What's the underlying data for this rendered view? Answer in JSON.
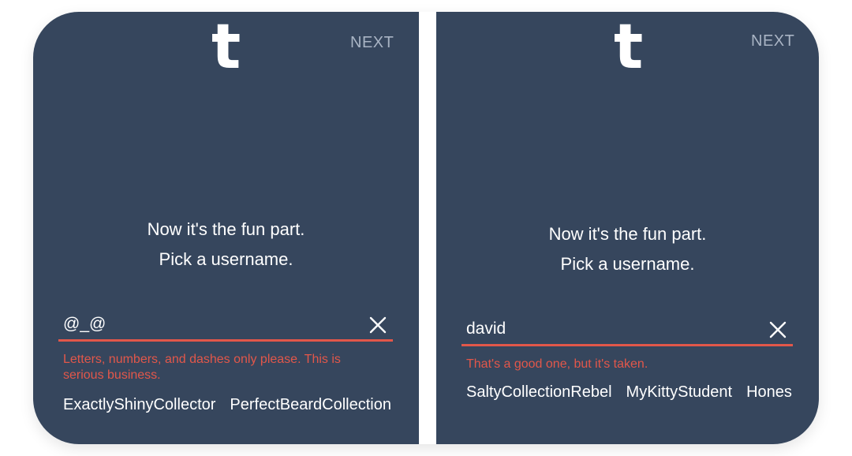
{
  "screens": [
    {
      "logo": "t",
      "next_label": "NEXT",
      "prompt_line1": "Now it's the fun part.",
      "prompt_line2": "Pick a username.",
      "username_value": "@_@",
      "clear_icon": "close-icon",
      "error_text": "Letters, numbers, and dashes only please. This is serious business.",
      "suggestions": [
        "ExactlyShinyCollector",
        "PerfectBeardCollection"
      ]
    },
    {
      "logo": "t",
      "next_label": "NEXT",
      "prompt_line1": "Now it's the fun part.",
      "prompt_line2": "Pick a username.",
      "username_value": "david",
      "clear_icon": "close-icon",
      "error_text": "That's a good one, but it's taken.",
      "suggestions": [
        "SaltyCollectionRebel",
        "MyKittyStudent",
        "Hones"
      ]
    }
  ],
  "colors": {
    "background": "#36465d",
    "error": "#e2574a",
    "next": "#a9b4c4",
    "text": "#ffffff"
  }
}
